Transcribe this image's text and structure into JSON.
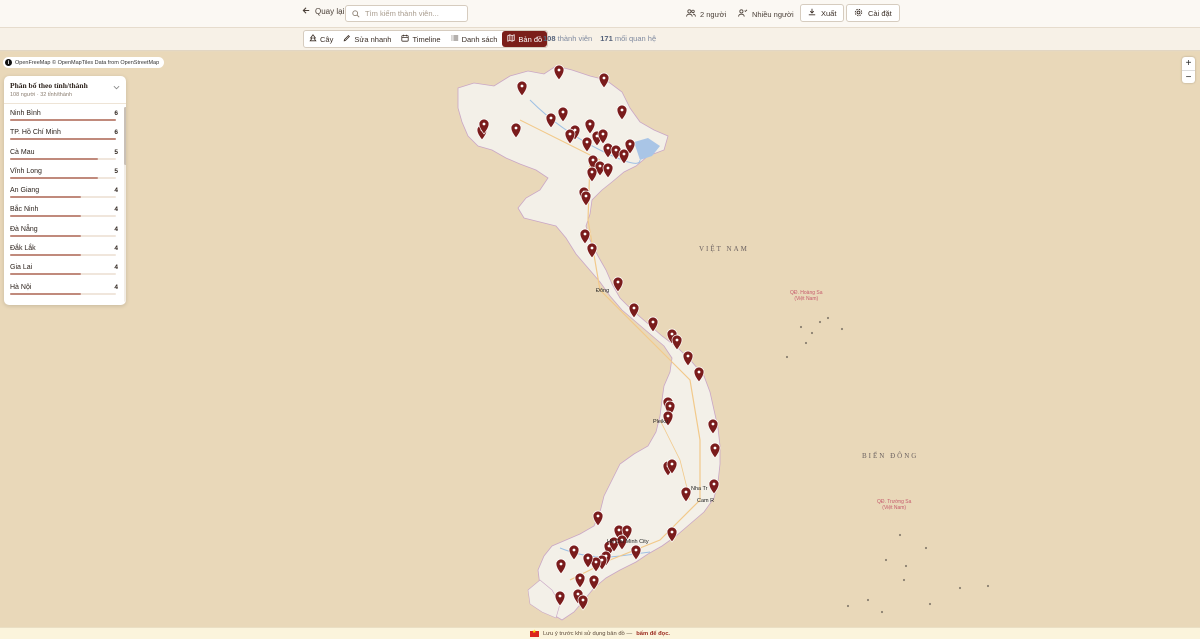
{
  "toolbar": {
    "back_label": "Quay lại",
    "search_placeholder": "Tìm kiếm thành viên...",
    "people_label": "2 người",
    "multi_people_label": "Nhiều người",
    "export_label": "Xuất",
    "settings_label": "Cài đặt"
  },
  "views": {
    "tabs": [
      {
        "label": "Cây",
        "icon": "tree-icon",
        "active": false
      },
      {
        "label": "Sửa nhanh",
        "icon": "pencil-icon",
        "active": false
      },
      {
        "label": "Timeline",
        "icon": "calendar-icon",
        "active": false
      },
      {
        "label": "Danh sách",
        "icon": "list-icon",
        "active": false
      },
      {
        "label": "Bản đồ",
        "icon": "map-icon",
        "active": true
      }
    ],
    "member_count": "108",
    "member_label": "thành viên",
    "relation_count": "171",
    "relation_label": "mối quan hệ"
  },
  "map": {
    "attribution": "OpenFreeMap © OpenMapTiles Data from OpenStreetMap",
    "country_label": "VIỆT NAM",
    "sea_label": "BIỂN ĐÔNG",
    "hoang_sa_1": "QĐ. Hoàng Sa",
    "hoang_sa_2": "(Việt Nam)",
    "truong_sa_1": "QĐ. Trường Sa",
    "truong_sa_2": "(Việt Nam)",
    "city_dong": "Đông",
    "city_pleiku": "Pleiku",
    "city_nha_trang": "Nha Tr",
    "city_cam": "Cam R",
    "city_hcm": "Hồ Chí Minh City",
    "zoom_in": "+",
    "zoom_out": "−"
  },
  "panel": {
    "title": "Phân bố theo tỉnh/thành",
    "subtitle": "108 người · 32 tỉnh/thành",
    "max": 6,
    "provinces": [
      {
        "name": "Ninh Bình",
        "count": 6
      },
      {
        "name": "TP. Hồ Chí Minh",
        "count": 6
      },
      {
        "name": "Cà Mau",
        "count": 5
      },
      {
        "name": "Vĩnh Long",
        "count": 5
      },
      {
        "name": "An Giang",
        "count": 4
      },
      {
        "name": "Bắc Ninh",
        "count": 4
      },
      {
        "name": "Đà Nẵng",
        "count": 4
      },
      {
        "name": "Đắk Lắk",
        "count": 4
      },
      {
        "name": "Gia Lai",
        "count": 4
      },
      {
        "name": "Hà Nội",
        "count": 4
      }
    ]
  },
  "footer": {
    "note": "Lưu ý trước khi sử dụng bản đồ —",
    "link": "bấm để đọc."
  },
  "colors": {
    "accent": "#7b1f1a",
    "pin": "#7a1c1c",
    "bar_fill": "#c08a7c",
    "land": "#f2efe7",
    "sea": "#e9d8b9"
  }
}
